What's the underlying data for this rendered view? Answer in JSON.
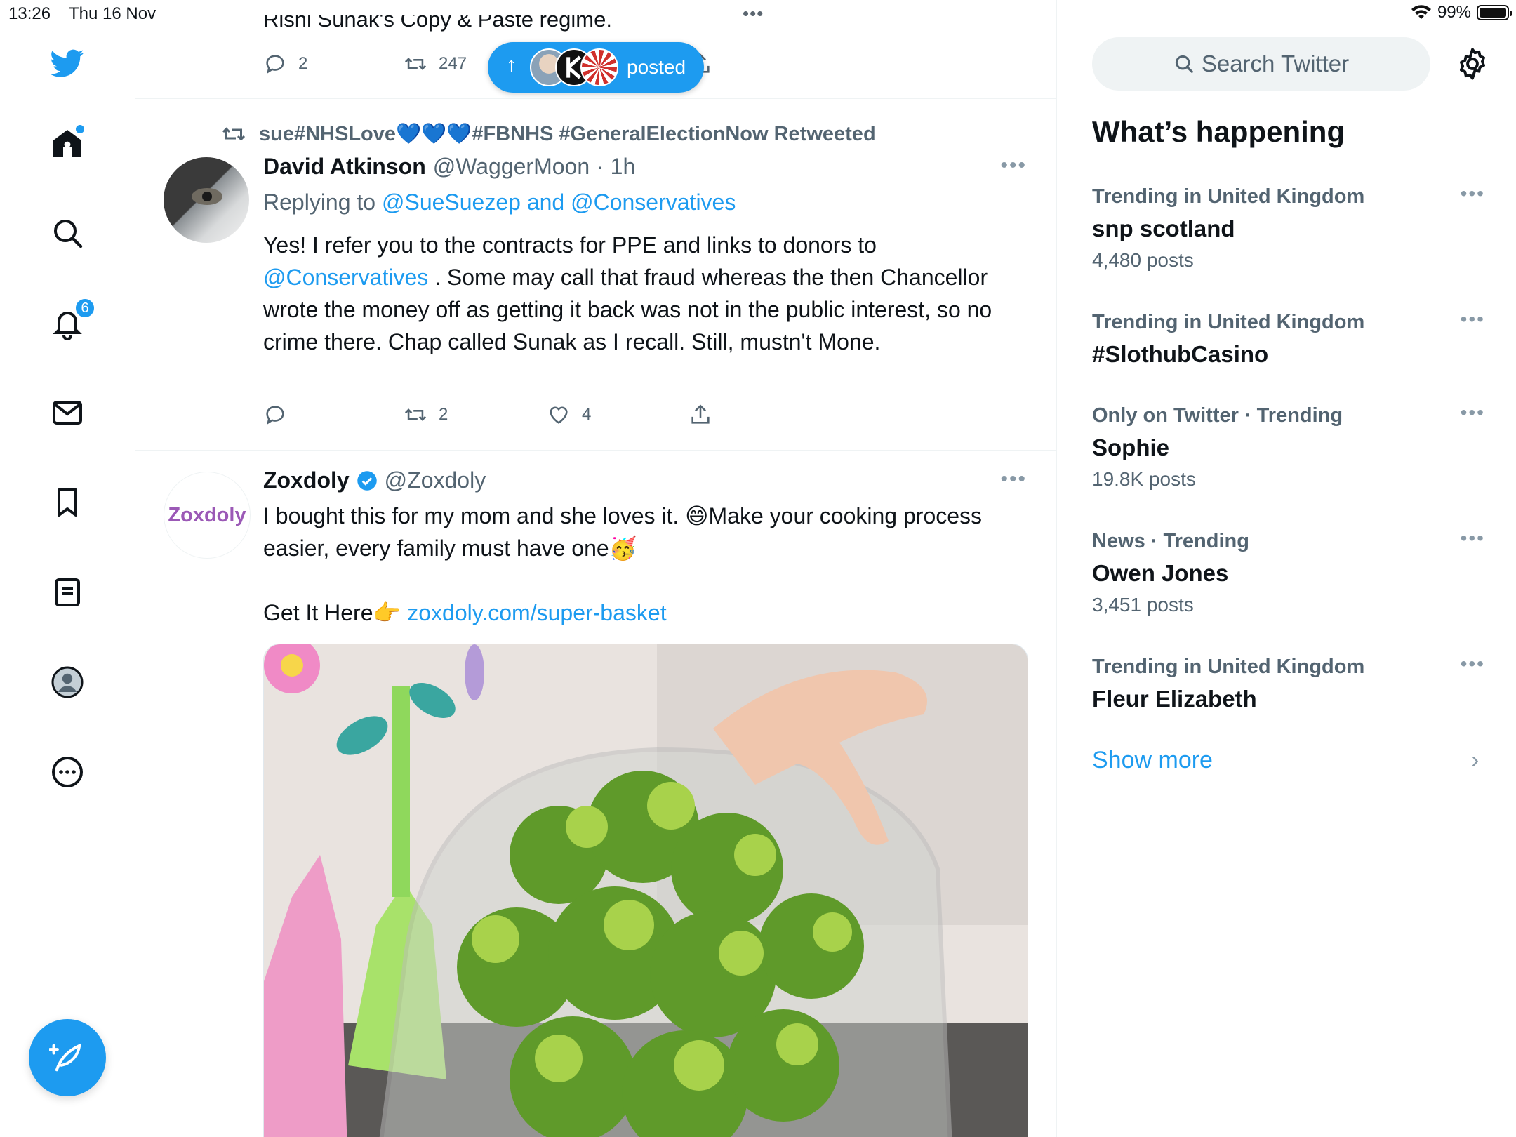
{
  "status_bar": {
    "time": "13:26",
    "date": "Thu 16 Nov",
    "dots": "•••",
    "battery": "99%",
    "battery_level": 0.99
  },
  "nav": {
    "notifications_badge": "6",
    "icons": [
      "twitter-logo-icon",
      "home-icon",
      "search-icon",
      "bell-icon",
      "mail-icon",
      "bookmark-icon",
      "lists-icon",
      "profile-icon",
      "more-icon",
      "compose-icon"
    ]
  },
  "feed": {
    "prev_tweet": {
      "cut_text": "Rishi Sunak's Copy & Paste regime.",
      "replies": "2",
      "retweets": "247"
    },
    "new_posts_pill": {
      "label": "posted",
      "arrow": "↑"
    },
    "tweets": [
      {
        "retweeted_by": "sue#NHSLove💙💙💙#FBNHS #GeneralElectionNow Retweeted",
        "name": "David Atkinson",
        "handle": "@WaggerMoon",
        "time": "· 1h",
        "reply_prefix": "Replying to",
        "reply_to": "@SueSuezep and @Conservatives",
        "text_1": "Yes! I refer you to the contracts for PPE and links to donors to",
        "mention": "@Conservatives",
        "text_2": ". Some may call that fraud whereas the then Chancellor wrote the money off as getting it back was not in the public interest, so no crime there. Chap called Sunak as I recall. Still, mustn't Mone.",
        "replies": "",
        "retweets": "2",
        "likes": "4",
        "more": "•••"
      },
      {
        "avatar_label": "Zoxdoly",
        "name": "Zoxdoly",
        "handle": "@Zoxdoly",
        "text_1": "I bought this for my mom and she loves it. 😄Make your cooking process easier, every family must have one🥳",
        "get_it": "Get It Here👉",
        "link": "zoxdoly.com/super-basket",
        "more": "•••"
      }
    ]
  },
  "sidebar": {
    "search_placeholder": "Search Twitter",
    "section_title": "What’s happening",
    "trends": [
      {
        "context": "Trending in United Kingdom",
        "name": "snp scotland",
        "count": "4,480 posts"
      },
      {
        "context": "Trending in United Kingdom",
        "name": "#SlothubCasino",
        "count": ""
      },
      {
        "context": "Only on Twitter · Trending",
        "name": "Sophie",
        "count": "19.8K posts"
      },
      {
        "context": "News · Trending",
        "name": "Owen Jones",
        "count": "3,451 posts"
      },
      {
        "context": "Trending in United Kingdom",
        "name": "Fleur Elizabeth",
        "count": ""
      }
    ],
    "trend_more": "•••",
    "show_more": "Show more",
    "chevron": "›"
  },
  "colors": {
    "accent": "#1d9bf0",
    "text": "#0f1419",
    "muted": "#536471"
  }
}
